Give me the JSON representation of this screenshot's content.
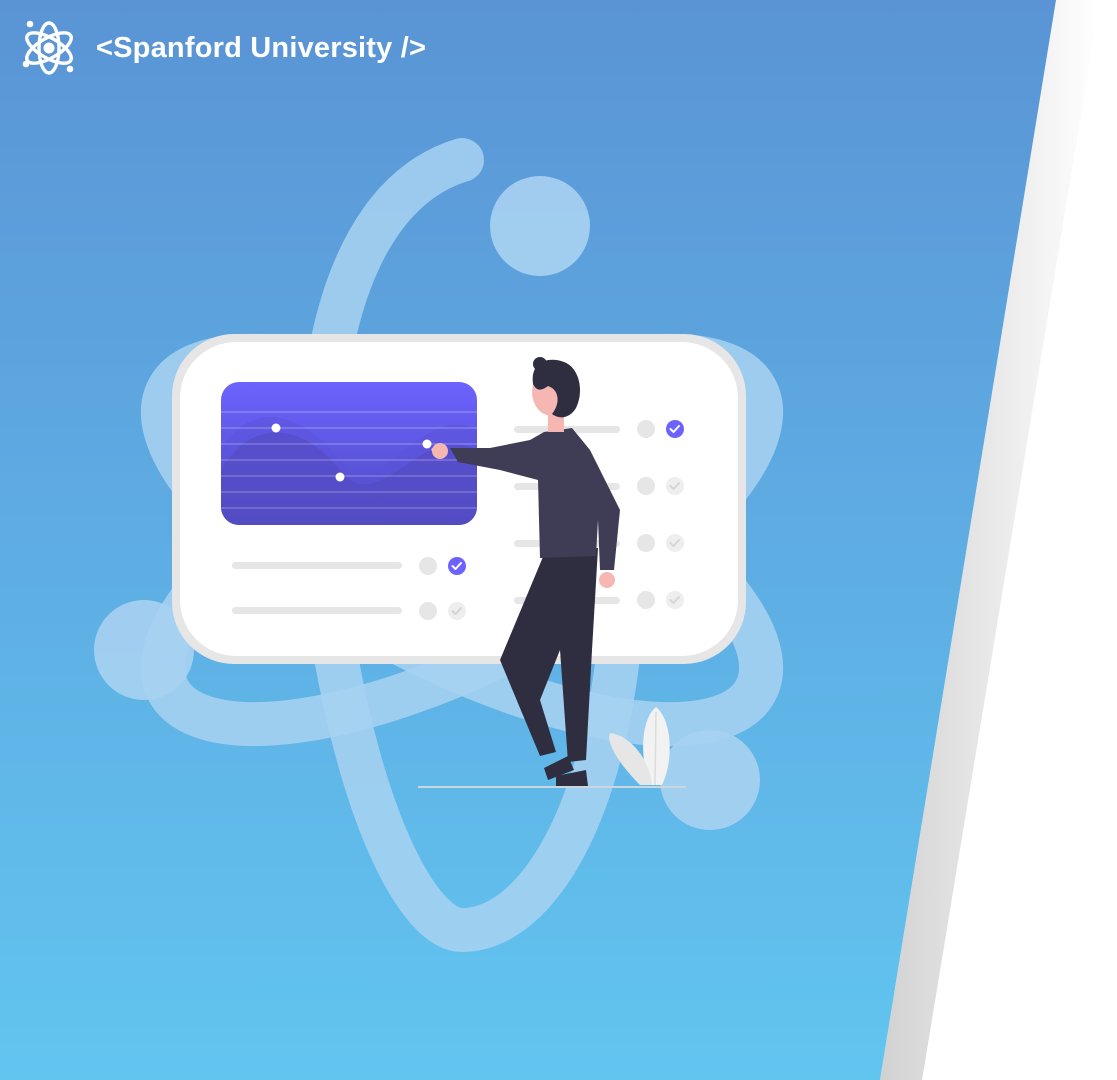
{
  "header": {
    "brand_name": "<Spanford University />",
    "logo_icon": "atom-icon"
  },
  "colors": {
    "gradient_top": "#5b94d6",
    "gradient_bottom": "#62c6f0",
    "atom_watermark": "#a9d4f2",
    "card_border": "#e6e6e6",
    "chart_top": "#6c63ff",
    "chart_bottom": "#4f4bc2",
    "person_clothes": "#2f2e41",
    "skin": "#f6b7b3",
    "check_active": "#6c63ff"
  },
  "illustration": {
    "subject": "person-presenting-dashboard",
    "checklist_left": [
      {
        "checked": true
      },
      {
        "checked": false
      }
    ],
    "checklist_right": [
      {
        "checked": true
      },
      {
        "checked": false
      },
      {
        "checked": false
      },
      {
        "checked": false
      }
    ]
  }
}
